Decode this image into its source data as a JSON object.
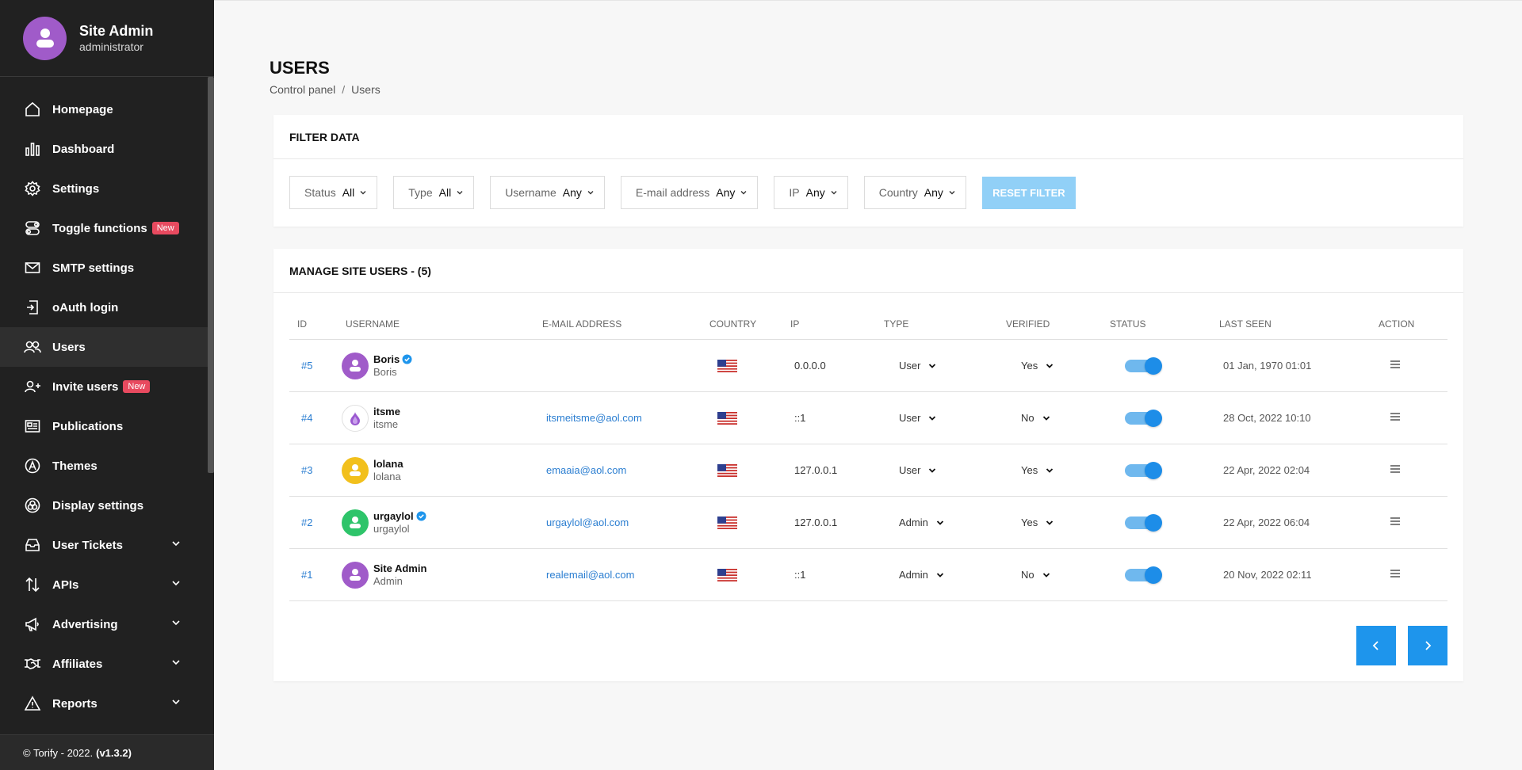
{
  "profile": {
    "name": "Site Admin",
    "role": "administrator"
  },
  "nav": [
    {
      "label": "Homepage",
      "icon": "home-icon"
    },
    {
      "label": "Dashboard",
      "icon": "bar-chart-icon"
    },
    {
      "label": "Settings",
      "icon": "gear-icon"
    },
    {
      "label": "Toggle functions",
      "icon": "toggle-icon",
      "badge": "New"
    },
    {
      "label": "SMTP settings",
      "icon": "mail-icon"
    },
    {
      "label": "oAuth login",
      "icon": "login-icon"
    },
    {
      "label": "Users",
      "icon": "users-icon",
      "active": true
    },
    {
      "label": "Invite users",
      "icon": "user-plus-icon",
      "badge": "New"
    },
    {
      "label": "Publications",
      "icon": "newspaper-icon"
    },
    {
      "label": "Themes",
      "icon": "theme-icon"
    },
    {
      "label": "Display settings",
      "icon": "display-icon"
    },
    {
      "label": "User Tickets",
      "icon": "ticket-icon",
      "expandable": true
    },
    {
      "label": "APIs",
      "icon": "api-icon",
      "expandable": true
    },
    {
      "label": "Advertising",
      "icon": "megaphone-icon",
      "expandable": true
    },
    {
      "label": "Affiliates",
      "icon": "handshake-icon",
      "expandable": true
    },
    {
      "label": "Reports",
      "icon": "warning-icon",
      "expandable": true
    }
  ],
  "footer": {
    "copyright": "© Torify - 2022.",
    "version": "(v1.3.2)"
  },
  "page": {
    "title": "USERS",
    "breadcrumb_root": "Control panel",
    "breadcrumb_sep": "/",
    "breadcrumb_current": "Users"
  },
  "filter": {
    "title": "FILTER DATA",
    "fields": [
      {
        "label": "Status",
        "value": "All"
      },
      {
        "label": "Type",
        "value": "All"
      },
      {
        "label": "Username",
        "value": "Any"
      },
      {
        "label": "E-mail address",
        "value": "Any"
      },
      {
        "label": "IP",
        "value": "Any"
      },
      {
        "label": "Country",
        "value": "Any"
      }
    ],
    "reset_label": "RESET FILTER"
  },
  "users": {
    "title": "MANAGE SITE USERS - (5)",
    "columns": [
      "ID",
      "USERNAME",
      "E-MAIL ADDRESS",
      "COUNTRY",
      "IP",
      "TYPE",
      "VERIFIED",
      "STATUS",
      "LAST SEEN",
      "ACTION"
    ],
    "rows": [
      {
        "id": "#5",
        "name": "Boris",
        "sub": "Boris",
        "verified_badge": true,
        "avatar_color": "#a05bc9",
        "email": "",
        "country": "US",
        "ip": "0.0.0.0",
        "type": "User",
        "verified": "Yes",
        "status": true,
        "last_seen": "01 Jan, 1970 01:01"
      },
      {
        "id": "#4",
        "name": "itsme",
        "sub": "itsme",
        "verified_badge": false,
        "avatar_color": "#ffffff",
        "email": "itsmeitsme@aol.com",
        "country": "US",
        "ip": "::1",
        "type": "User",
        "verified": "No",
        "status": true,
        "last_seen": "28 Oct, 2022 10:10"
      },
      {
        "id": "#3",
        "name": "lolana",
        "sub": "lolana",
        "verified_badge": false,
        "avatar_color": "#f2c01c",
        "email": "emaaia@aol.com",
        "country": "US",
        "ip": "127.0.0.1",
        "type": "User",
        "verified": "Yes",
        "status": true,
        "last_seen": "22 Apr, 2022 02:04"
      },
      {
        "id": "#2",
        "name": "urgaylol",
        "sub": "urgaylol",
        "verified_badge": true,
        "avatar_color": "#2ec46a",
        "email": "urgaylol@aol.com",
        "country": "US",
        "ip": "127.0.0.1",
        "type": "Admin",
        "verified": "Yes",
        "status": true,
        "last_seen": "22 Apr, 2022 06:04"
      },
      {
        "id": "#1",
        "name": "Site Admin",
        "sub": "Admin",
        "verified_badge": false,
        "avatar_color": "#a05bc9",
        "email": "realemail@aol.com",
        "country": "US",
        "ip": "::1",
        "type": "Admin",
        "verified": "No",
        "status": true,
        "last_seen": "20 Nov, 2022 02:11"
      }
    ]
  },
  "colors": {
    "sidebar": "#212121",
    "accent": "#1e95ec",
    "badge": "#e84a5f",
    "link": "#2b7ed1"
  }
}
